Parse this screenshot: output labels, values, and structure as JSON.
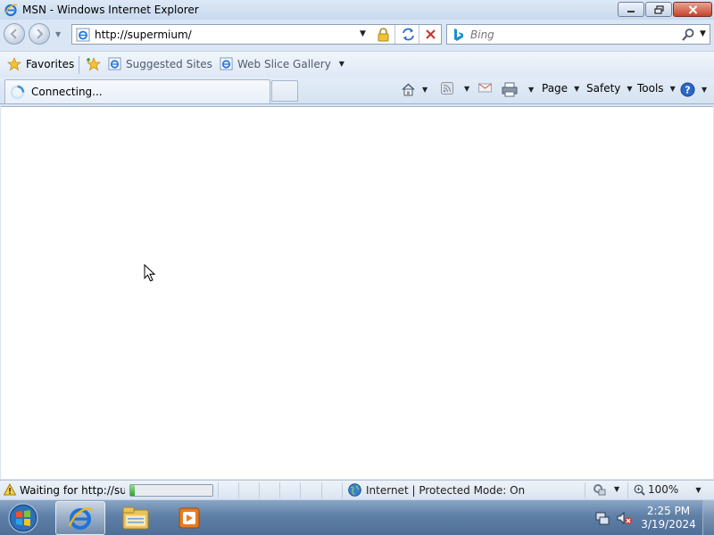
{
  "window": {
    "title": "MSN - Windows Internet Explorer"
  },
  "address": {
    "url": "http://supermium/"
  },
  "search": {
    "placeholder": "Bing"
  },
  "favorites_bar": {
    "favorites_label": "Favorites",
    "items": [
      "Suggested Sites",
      "Web Slice Gallery"
    ]
  },
  "tab": {
    "title": "Connecting..."
  },
  "command_bar": {
    "page_label": "Page",
    "safety_label": "Safety",
    "tools_label": "Tools"
  },
  "status_bar": {
    "status_text": "Waiting for http://supe",
    "progress_percent": 5,
    "zone_text": "Internet | Protected Mode: On",
    "zoom_text": "100%"
  },
  "taskbar": {
    "time": "2:25 PM",
    "date": "3/19/2024"
  },
  "colors": {
    "accent": "#1f5fbf",
    "title_bar": "#c9daee",
    "progress_fill": "#2aa52a"
  },
  "icons": [
    "ie-logo-icon",
    "back-icon",
    "forward-icon",
    "lock-icon",
    "refresh-icon",
    "stop-icon",
    "bing-icon",
    "search-icon",
    "star-icon",
    "add-favorite-icon",
    "loading-spinner-icon",
    "home-icon",
    "feeds-icon",
    "read-mail-icon",
    "print-icon",
    "help-icon",
    "warning-icon",
    "globe-icon",
    "zoom-icon",
    "start-orb-icon",
    "explorer-icon",
    "media-player-icon",
    "network-icon",
    "volume-muted-icon"
  ]
}
